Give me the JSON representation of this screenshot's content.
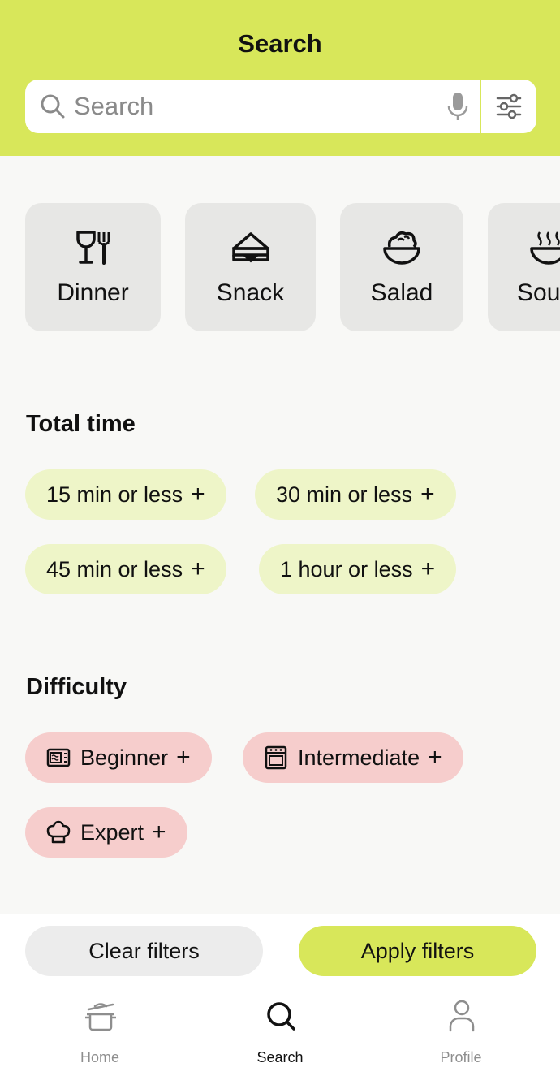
{
  "header": {
    "title": "Search",
    "search_placeholder": "Search",
    "search_value": ""
  },
  "categories": [
    {
      "label": "Dinner",
      "icon": "wine-fork-icon"
    },
    {
      "label": "Snack",
      "icon": "sandwich-icon"
    },
    {
      "label": "Salad",
      "icon": "salad-bowl-icon"
    },
    {
      "label": "Sou",
      "icon": "soup-bowl-icon"
    }
  ],
  "total_time": {
    "title": "Total time",
    "options": [
      {
        "label": "15 min or less",
        "plus": "+"
      },
      {
        "label": "30 min or less",
        "plus": "+"
      },
      {
        "label": "45 min or less",
        "plus": "+"
      },
      {
        "label": "1 hour or less",
        "plus": "+"
      }
    ]
  },
  "difficulty": {
    "title": "Difficulty",
    "options": [
      {
        "label": "Beginner",
        "plus": "+",
        "icon": "microwave-icon"
      },
      {
        "label": "Intermediate",
        "plus": "+",
        "icon": "oven-icon"
      },
      {
        "label": "Expert",
        "plus": "+",
        "icon": "chef-hat-icon"
      }
    ]
  },
  "actions": {
    "clear_label": "Clear filters",
    "apply_label": "Apply filters"
  },
  "nav": {
    "items": [
      {
        "label": "Home",
        "icon": "pot-icon",
        "active": false
      },
      {
        "label": "Search",
        "icon": "search-icon",
        "active": true
      },
      {
        "label": "Profile",
        "icon": "person-icon",
        "active": false
      }
    ]
  },
  "colors": {
    "accent": "#d8e75a",
    "time_chip": "#eef5c8",
    "difficulty_chip": "#f6cdcc",
    "category_card": "#e7e7e5"
  }
}
